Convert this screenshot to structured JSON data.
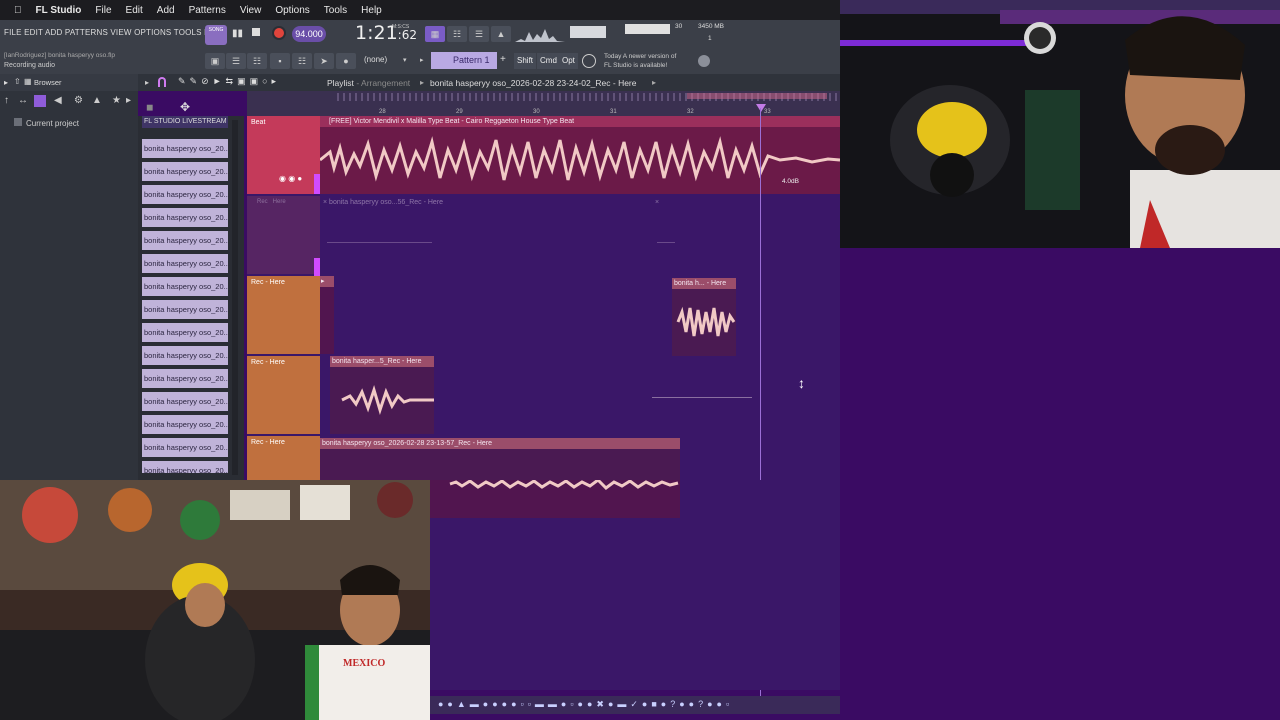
{
  "mac_menu": {
    "apple": "",
    "app": "FL Studio",
    "items": [
      "File",
      "Edit",
      "Add",
      "Patterns",
      "View",
      "Options",
      "Tools",
      "Help"
    ]
  },
  "fl_toolbar": {
    "menu_text": "FILE  EDIT  ADD  PATTERNS  VIEW  OPTIONS  TOOLS  HELP",
    "hint_file": "[IanRodriguez] bonita hasperyy oso.flp",
    "hint_status": "Recording audio",
    "song_mode": "SONG",
    "tempo": "94.000",
    "clock_main": "1:21",
    "clock_ticks": ":62",
    "clock_unit": "M:S:CS",
    "pattern": "Pattern 1",
    "none_label": "(none)",
    "shift": "Shift",
    "cmd": "Cmd",
    "opt": "Opt",
    "news_1": "Today  A newer version of",
    "news_2": "FL Studio is available!",
    "mem_1": "30",
    "mem_2": "3450 MB",
    "mem_3": "1"
  },
  "browser": {
    "title": "Browser",
    "item": "Current project"
  },
  "channels": {
    "header": "FL STUDIO LIVESTREAM T...",
    "items": [
      "bonita hasperyy oso_20...",
      "bonita hasperyy oso_20...",
      "bonita hasperyy oso_20...",
      "bonita hasperyy oso_20...",
      "bonita hasperyy oso_20...",
      "bonita hasperyy oso_20...",
      "bonita hasperyy oso_20...",
      "bonita hasperyy oso_20...",
      "bonita hasperyy oso_20...",
      "bonita hasperyy oso_20...",
      "bonita hasperyy oso_20...",
      "bonita hasperyy oso_20...",
      "bonita hasperyy oso_20...",
      "bonita hasperyy oso_20...",
      "bonita hasperyy oso_20..."
    ]
  },
  "playlist": {
    "title": "Playlist",
    "subtitle": "- Arrangement",
    "file": "bonita hasperyy oso_2026-02-28 23-24-02_Rec - Here",
    "ruler": [
      "28",
      "29",
      "30",
      "31",
      "32",
      "33"
    ],
    "tracks": [
      {
        "label": "Beat"
      },
      {
        "label": "Rec - Here"
      },
      {
        "label": "Rec - Here"
      },
      {
        "label": "Rec - Here"
      },
      {
        "label": "Rec - Here"
      }
    ],
    "clips": {
      "beat": "[FREE] Victor Mendivil x Malilla Type Beat - Cairo  Reggaeton House Type Beat",
      "beat_gain": "4.0dB",
      "ghost": "bonita hasperyy oso...56_Rec - Here",
      "clip_a": "bonita h... - Here",
      "clip_b": "bonita hasper...5_Rec - Here",
      "clip_c": "bonita hasperyy oso_2026-02-28 23-13-57_Rec - Here"
    }
  },
  "colors": {
    "beat_track": "#c43a5a",
    "rec_track": "#c0703e",
    "clip_header": "#9b4d6a",
    "clip_body": "#51154f",
    "wave_light": "#f1c9c5",
    "bg_purple": "#3a1768",
    "playhead": "#9b6fd6"
  },
  "icons": [
    "apple-icon",
    "play-icon",
    "stop-icon",
    "record-icon",
    "magnet-icon",
    "pencil-icon",
    "metronome-icon",
    "mixer-icon",
    "piano-roll-icon",
    "browser-icon",
    "plugin-icon",
    "cursor-resize-icon"
  ]
}
